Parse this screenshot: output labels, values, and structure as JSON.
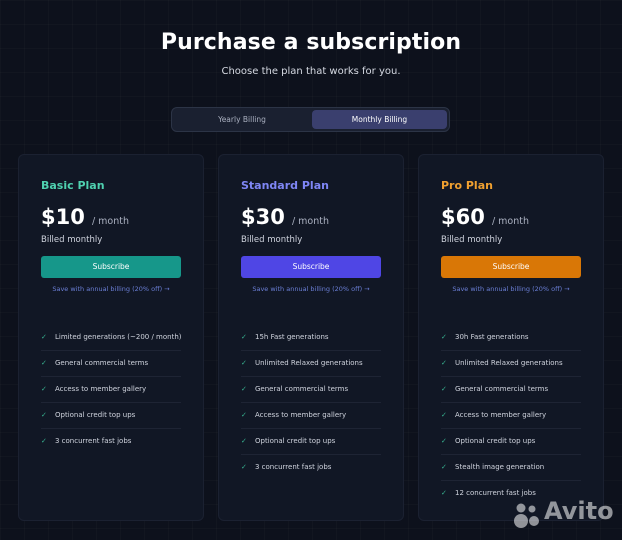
{
  "header": {
    "title": "Purchase a subscription",
    "subtitle": "Choose the plan that works for you."
  },
  "billing_toggle": {
    "yearly_label": "Yearly Billing",
    "monthly_label": "Monthly Billing",
    "selected": "Monthly Billing"
  },
  "plans": [
    {
      "name": "Basic Plan",
      "name_color": "#4fd1b0",
      "price": "$10",
      "per": "/ month",
      "billed": "Billed monthly",
      "button_label": "Subscribe",
      "button_color": "#16978a",
      "save_note": "Save with annual billing (20% off) →",
      "features": [
        "Limited generations (~200 / month)",
        "General commercial terms",
        "Access to member gallery",
        "Optional credit top ups",
        "3 concurrent fast jobs"
      ]
    },
    {
      "name": "Standard Plan",
      "name_color": "#7f86f5",
      "price": "$30",
      "per": "/ month",
      "billed": "Billed monthly",
      "button_label": "Subscribe",
      "button_color": "#4f46e5",
      "save_note": "Save with annual billing (20% off) →",
      "features": [
        "15h Fast generations",
        "Unlimited Relaxed generations",
        "General commercial terms",
        "Access to member gallery",
        "Optional credit top ups",
        "3 concurrent fast jobs"
      ]
    },
    {
      "name": "Pro Plan",
      "name_color": "#f0a030",
      "price": "$60",
      "per": "/ month",
      "billed": "Billed monthly",
      "button_label": "Subscribe",
      "button_color": "#d97706",
      "save_note": "Save with annual billing (20% off) →",
      "features": [
        "30h Fast generations",
        "Unlimited Relaxed generations",
        "General commercial terms",
        "Access to member gallery",
        "Optional credit top ups",
        "Stealth image generation",
        "12 concurrent fast jobs"
      ]
    }
  ],
  "watermark": {
    "text": "Avito",
    "icon": "avito-dots-logo"
  }
}
